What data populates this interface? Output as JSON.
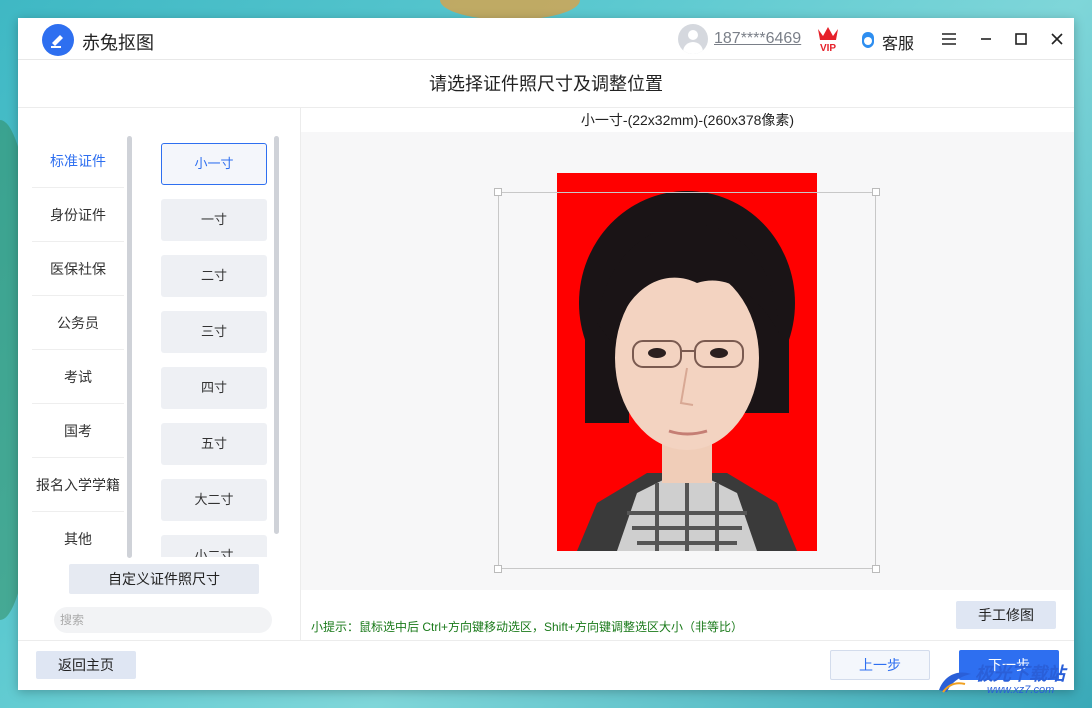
{
  "app": {
    "name": "赤兔抠图"
  },
  "titlebar": {
    "account": "187****6469",
    "vip": "VIP",
    "service": "客服"
  },
  "page": {
    "title": "请选择证件照尺寸及调整位置"
  },
  "categories": [
    {
      "label": "标准证件",
      "active": true
    },
    {
      "label": "身份证件"
    },
    {
      "label": "医保社保"
    },
    {
      "label": "公务员"
    },
    {
      "label": "考试"
    },
    {
      "label": "国考"
    },
    {
      "label": "报名入学学籍"
    },
    {
      "label": "其他"
    }
  ],
  "sizes": [
    {
      "label": "小一寸",
      "active": true
    },
    {
      "label": "一寸"
    },
    {
      "label": "二寸"
    },
    {
      "label": "三寸"
    },
    {
      "label": "四寸"
    },
    {
      "label": "五寸"
    },
    {
      "label": "大二寸"
    },
    {
      "label": "小二寸"
    }
  ],
  "custom_button": "自定义证件照尺寸",
  "search": {
    "placeholder": "搜索"
  },
  "preview": {
    "spec": "小一寸-(22x32mm)-(260x378像素)",
    "background_color": "#ff0000"
  },
  "tip": "小提示：鼠标选中后 Ctrl+方向键移动选区，Shift+方向键调整选区大小（非等比）",
  "manual_button": "手工修图",
  "footer": {
    "home": "返回主页",
    "prev": "上一步",
    "next": "下一步"
  },
  "watermark": {
    "text": "极光下载站",
    "url": "www.xz7.com"
  },
  "colors": {
    "accent": "#2e6ff0",
    "tip": "#1a7a1a"
  }
}
